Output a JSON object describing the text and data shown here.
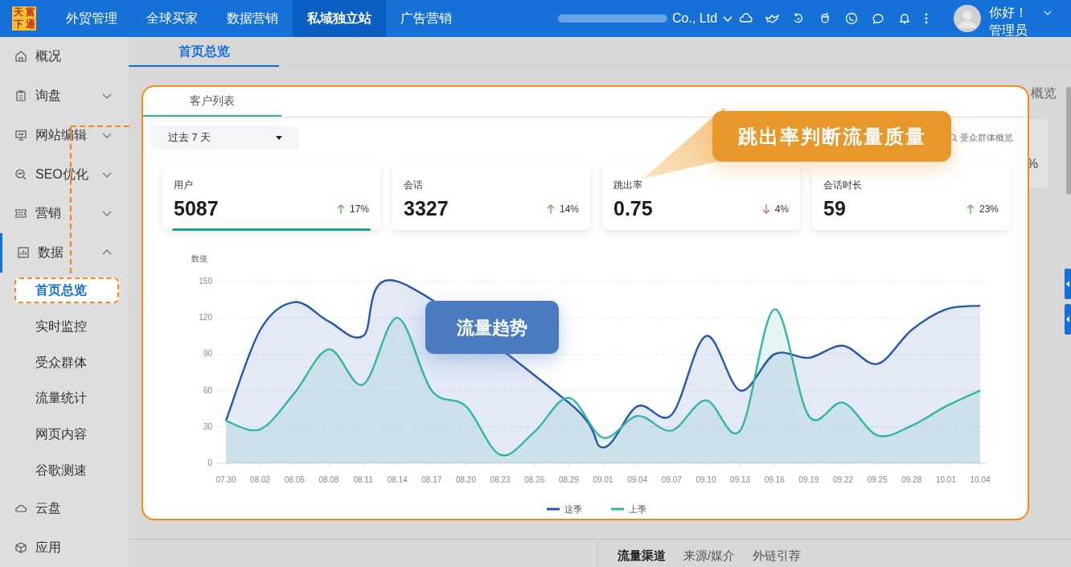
{
  "top_nav": {
    "logo": [
      "天",
      "富",
      "下",
      "通"
    ],
    "menu": [
      {
        "label": "外贸管理",
        "selected": false
      },
      {
        "label": "全球买家",
        "selected": false
      },
      {
        "label": "数据营销",
        "selected": false
      },
      {
        "label": "私域独立站",
        "selected": true
      },
      {
        "label": "广告营销",
        "selected": false
      }
    ],
    "company": "Co., Ltd",
    "greeting": "你好！",
    "role": "管理员"
  },
  "sidebar": {
    "items": [
      {
        "label": "概况"
      },
      {
        "label": "询盘",
        "expanded": false
      },
      {
        "label": "网站编辑",
        "expanded": false
      },
      {
        "label": "SEO优化",
        "expanded": false
      },
      {
        "label": "营销",
        "expanded": false
      },
      {
        "label": "数据",
        "expanded": true,
        "selected": true,
        "children": [
          {
            "label": "首页总览",
            "selected": true
          },
          {
            "label": "实时监控",
            "selected": false
          },
          {
            "label": "受众群体",
            "selected": false
          },
          {
            "label": "流量统计",
            "selected": false
          },
          {
            "label": "网页内容",
            "selected": false
          },
          {
            "label": "谷歌测速",
            "selected": false
          }
        ]
      },
      {
        "label": "云盘"
      },
      {
        "label": "应用"
      }
    ]
  },
  "page_tabs": [
    {
      "label": "首页总览",
      "selected": true
    }
  ],
  "background_panel": {
    "title_fragment": "概览",
    "value_fragment": "%",
    "tabs": [
      "流量渠道",
      "来源/媒介",
      "外链引荐"
    ]
  },
  "card": {
    "tabs": [
      {
        "label": "客户列表",
        "selected": true
      }
    ],
    "range": "过去 7 天",
    "link": "受众群体概览",
    "metrics": [
      {
        "label": "用户",
        "value": "5087",
        "change": "17%",
        "increase": true,
        "selected": true
      },
      {
        "label": "会话",
        "value": "3327",
        "change": "14%",
        "increase": true,
        "selected": false
      },
      {
        "label": "跳出率",
        "value": "0.75",
        "change": "4%",
        "increase": false,
        "selected": false
      },
      {
        "label": "会话时长",
        "value": "59",
        "change": "23%",
        "increase": true,
        "selected": false
      }
    ],
    "chart_data": {
      "type": "area",
      "ylabel": "数值",
      "categories": [
        "07.30",
        "08.02",
        "08.05",
        "08.08",
        "08.11",
        "08.14",
        "08.17",
        "08.20",
        "08.23",
        "08.26",
        "08.29",
        "09.01",
        "09.04",
        "09.07",
        "09.10",
        "09.13",
        "09.16",
        "09.19",
        "09.22",
        "09.25",
        "09.28",
        "10.01",
        "10.04"
      ],
      "series": [
        {
          "name": "这季",
          "color": "#2456b0",
          "values": [
            35,
            110,
            133,
            117,
            105,
            150,
            null,
            null,
            null,
            null,
            50,
            13,
            47,
            40,
            105,
            60,
            90,
            87,
            97,
            82,
            110,
            127,
            130
          ]
        },
        {
          "name": "上季",
          "color": "#33b5a5",
          "values": [
            35,
            28,
            58,
            94,
            65,
            120,
            60,
            47,
            7,
            26,
            54,
            21,
            39,
            27,
            52,
            27,
            127,
            39,
            50,
            23,
            31,
            47,
            60
          ]
        }
      ],
      "ylim": [
        0,
        150
      ],
      "yticks": [
        0,
        30,
        60,
        90,
        120,
        150
      ],
      "grid": true,
      "legend": true
    }
  },
  "callouts": [
    {
      "text": "跳出率判断流量质量",
      "kind": "orange"
    },
    {
      "text": "流量趋势",
      "kind": "blue"
    }
  ]
}
